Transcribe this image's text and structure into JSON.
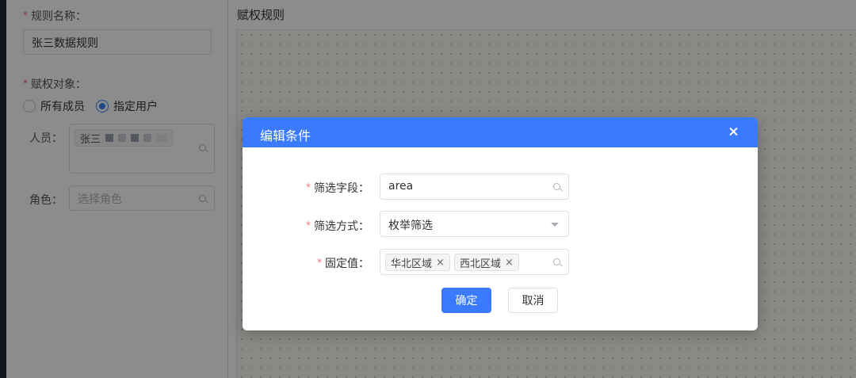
{
  "left_form": {
    "rule_name_label": "规则名称：",
    "rule_name_value": "张三数据规则",
    "grant_target_label": "赋权对象：",
    "radio_all_label": "所有成员",
    "radio_specified_label": "指定用户",
    "selected_radio": "指定用户",
    "person_label": "人员：",
    "person_tag": "张三",
    "role_label": "角色：",
    "role_placeholder": "选择角色"
  },
  "right_panel": {
    "title": "赋权规则"
  },
  "dialog": {
    "title": "编辑条件",
    "field_label": "筛选字段：",
    "field_value": "area",
    "method_label": "筛选方式：",
    "method_value": "枚举筛选",
    "fixed_label": "固定值：",
    "fixed_tags": [
      "华北区域",
      "西北区域"
    ],
    "tag_close": "×",
    "confirm_label": "确定",
    "cancel_label": "取消"
  },
  "colors": {
    "primary": "#3a7afe",
    "required_mark": "#f56c6c",
    "mask": "rgba(0,0,0,0.45)"
  },
  "icons": [
    "search-icon",
    "close-icon",
    "caret-down-icon",
    "radio-icon"
  ]
}
